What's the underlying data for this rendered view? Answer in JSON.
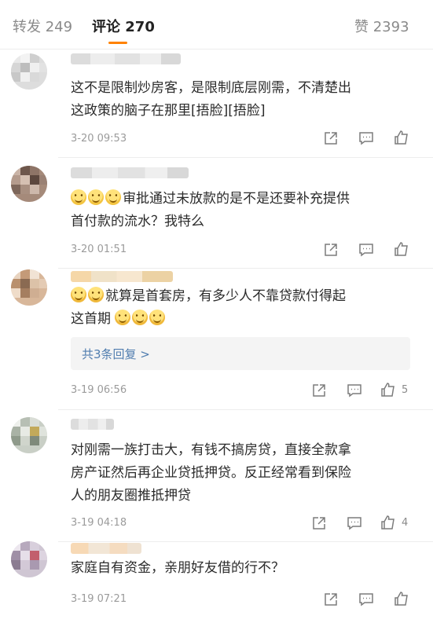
{
  "tabs": {
    "repost": "转发 249",
    "comments": "评论 270",
    "likes": "赞 2393",
    "accent": "#ff8200"
  },
  "comments": [
    {
      "lines": [
        "这不是限制炒房客，是限制底层刚需，不清楚出",
        "这政策的脑子在那里[捂脸][捂脸]"
      ],
      "time": "3-20 09:53"
    },
    {
      "lines": [
        "审批通过未放款的是不是还要补充提供",
        "首付款的流水？我特么"
      ],
      "time": "3-20 01:51"
    },
    {
      "lines": [
        "就算是首套房，有多少人不靠贷款付得起",
        "这首期"
      ],
      "reply": "共3条回复 >",
      "time": "3-19 06:56",
      "likes": "5"
    },
    {
      "lines": [
        "对刚需一族打击大，有钱不搞房贷，直接全款拿",
        "房产证然后再企业贷抵押贷。反正经常看到保险",
        "人的朋友圈推抵押贷"
      ],
      "time": "3-19 04:18",
      "likes": "4"
    },
    {
      "lines": [
        "家庭自有资金，亲朋好友借的行不？"
      ],
      "time": "3-19 07:21"
    }
  ],
  "icons": [
    "share-icon",
    "comment-icon",
    "like-icon",
    "emoji-smile-icon",
    "emoji-cry-icon"
  ]
}
